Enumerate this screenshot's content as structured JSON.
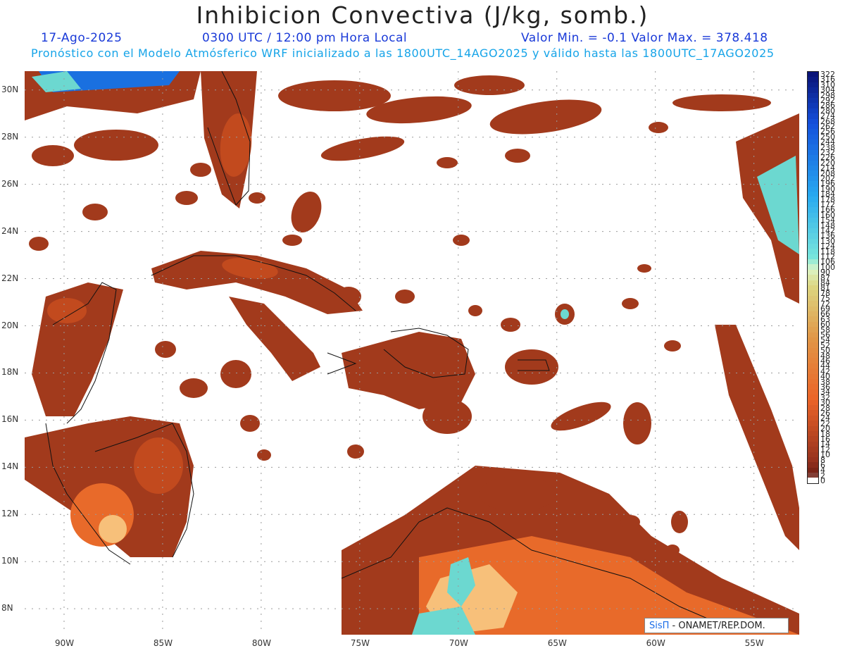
{
  "header": {
    "title": "Inhibicion Convectiva (J/kg, somb.)",
    "date": "17-Ago-2025",
    "time": "0300 UTC / 12:00 pm Hora Local",
    "minmax": "Valor Min. = -0.1  Valor Max. = 378.418",
    "forecast": "Pronóstico con el Modelo Atmósferico WRF inicializado a las 1800UTC_14AGO2025 y válido hasta las  1800UTC_17AGO2025"
  },
  "map": {
    "lat_labels": [
      "30N",
      "28N",
      "26N",
      "24N",
      "22N",
      "20N",
      "18N",
      "16N",
      "14N",
      "12N",
      "10N",
      "8N"
    ],
    "lon_labels": [
      "90W",
      "85W",
      "80W",
      "75W",
      "70W",
      "65W",
      "60W",
      "55W"
    ],
    "lon_range": [
      -92,
      -52.7
    ],
    "lat_range": [
      6.9,
      30.8
    ],
    "colors": {
      "land": "#a23a1c",
      "land_mid": "#c24a1e",
      "warm": "#e86a2a",
      "hot": "#f7c07a",
      "cool": "#6cd8d0",
      "cold": "#1a70e0",
      "coast": "#111111",
      "grid": "#9a9a9a"
    },
    "credit_logo": "SisΠ",
    "credit_text": " - ONAMET/REP.DOM."
  },
  "colorbar": {
    "labels": [
      "322",
      "316",
      "310",
      "304",
      "298",
      "292",
      "286",
      "280",
      "274",
      "268",
      "262",
      "256",
      "250",
      "244",
      "238",
      "232",
      "226",
      "220",
      "214",
      "208",
      "202",
      "196",
      "190",
      "184",
      "178",
      "172",
      "166",
      "160",
      "154",
      "148",
      "142",
      "136",
      "130",
      "124",
      "118",
      "112",
      "106",
      "100",
      "90",
      "87",
      "84",
      "81",
      "78",
      "75",
      "72",
      "69",
      "66",
      "63",
      "60",
      "58",
      "56",
      "54",
      "52",
      "50",
      "48",
      "46",
      "44",
      "42",
      "40",
      "38",
      "36",
      "34",
      "32",
      "30",
      "28",
      "26",
      "24",
      "22",
      "20",
      "18",
      "16",
      "14",
      "12",
      "10",
      "8",
      "6",
      "4",
      "2",
      "0"
    ]
  }
}
